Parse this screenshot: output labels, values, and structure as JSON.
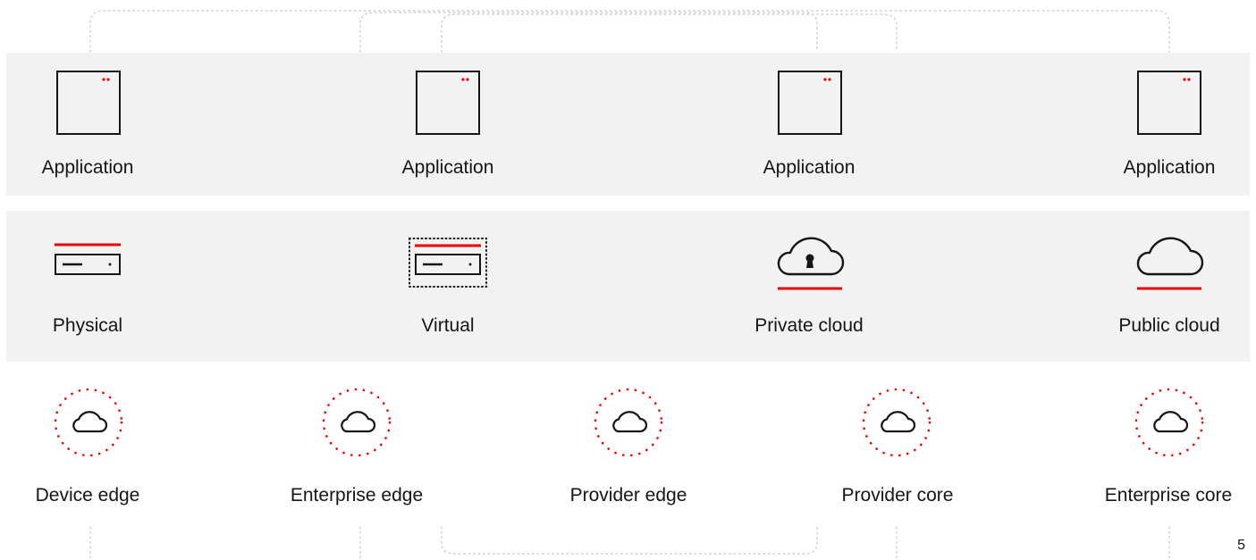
{
  "applications": {
    "items": [
      {
        "label": "Application",
        "icon": "application-window-icon"
      },
      {
        "label": "Application",
        "icon": "application-window-icon"
      },
      {
        "label": "Application",
        "icon": "application-window-icon"
      },
      {
        "label": "Application",
        "icon": "application-window-icon"
      }
    ]
  },
  "infrastructure": {
    "items": [
      {
        "label": "Physical",
        "icon": "server-icon"
      },
      {
        "label": "Virtual",
        "icon": "virtual-server-icon"
      },
      {
        "label": "Private cloud",
        "icon": "private-cloud-lock-icon"
      },
      {
        "label": "Public cloud",
        "icon": "public-cloud-icon"
      }
    ]
  },
  "footprints": {
    "items": [
      {
        "label": "Device edge",
        "icon": "edge-cloud-icon"
      },
      {
        "label": "Enterprise edge",
        "icon": "edge-cloud-icon"
      },
      {
        "label": "Provider edge",
        "icon": "edge-cloud-icon"
      },
      {
        "label": "Provider core",
        "icon": "edge-cloud-icon"
      },
      {
        "label": "Enterprise core",
        "icon": "edge-cloud-icon"
      }
    ]
  },
  "page_number": "5",
  "colors": {
    "accent": "#ee0000",
    "band": "#f2f2f2",
    "stroke": "#151515",
    "connector": "#cfcfcf"
  }
}
